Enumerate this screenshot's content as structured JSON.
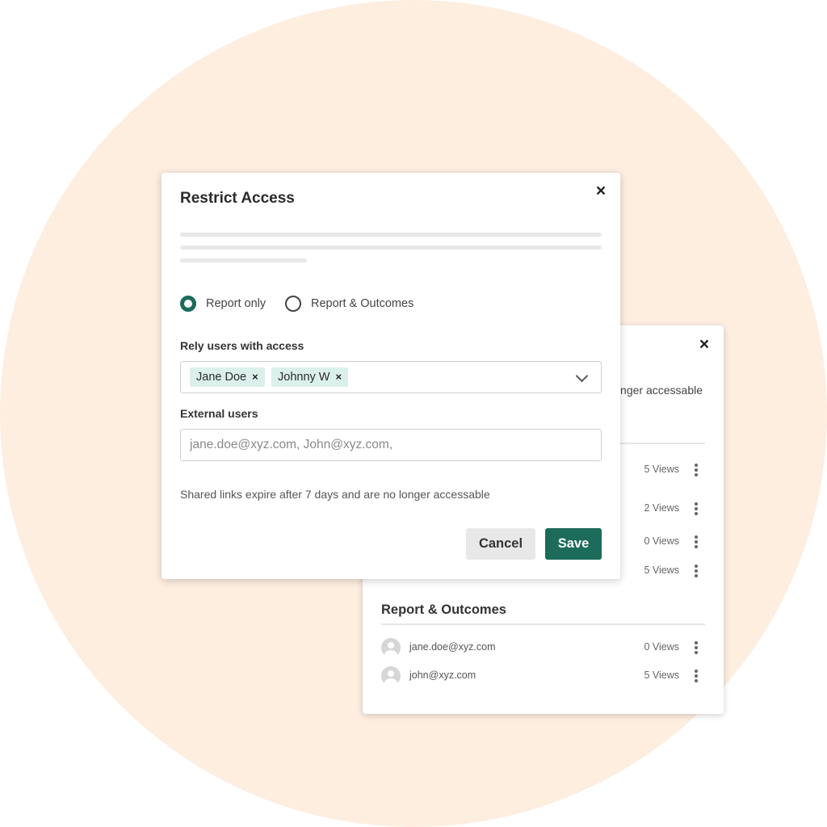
{
  "back_card": {
    "close_icon": "×",
    "note": "nger accessable",
    "rows_top": [
      {
        "views": "5 Views"
      },
      {
        "views": "2 Views"
      },
      {
        "views": "0 Views"
      },
      {
        "views": "5 Views"
      }
    ],
    "section_title": "Report & Outcomes",
    "rows_bottom": [
      {
        "email": "jane.doe@xyz.com",
        "views": "0 Views"
      },
      {
        "email": "john@xyz.com",
        "views": "5 Views"
      }
    ]
  },
  "modal": {
    "title": "Restrict Access",
    "close_icon": "×",
    "radio_options": [
      {
        "label": "Report only",
        "checked": true
      },
      {
        "label": "Report & Outcomes",
        "checked": false
      }
    ],
    "rely_users_label": "Rely users with access",
    "chips": [
      {
        "label": "Jane Doe",
        "remove": "×"
      },
      {
        "label": "Johnny W",
        "remove": "×"
      }
    ],
    "external_users_label": "External users",
    "external_users_placeholder": "jane.doe@xyz.com, John@xyz.com,",
    "hint": "Shared links expire after 7 days and are no longer accessable",
    "cancel_label": "Cancel",
    "save_label": "Save"
  },
  "colors": {
    "accent": "#1c6b5b",
    "chip_bg": "#dbf0ea",
    "background_circle": "#fdeee0"
  },
  "icons": {
    "close": "close-icon",
    "chevron": "chevron-down-icon",
    "kebab": "kebab-menu-icon",
    "avatar": "user-avatar-icon"
  }
}
